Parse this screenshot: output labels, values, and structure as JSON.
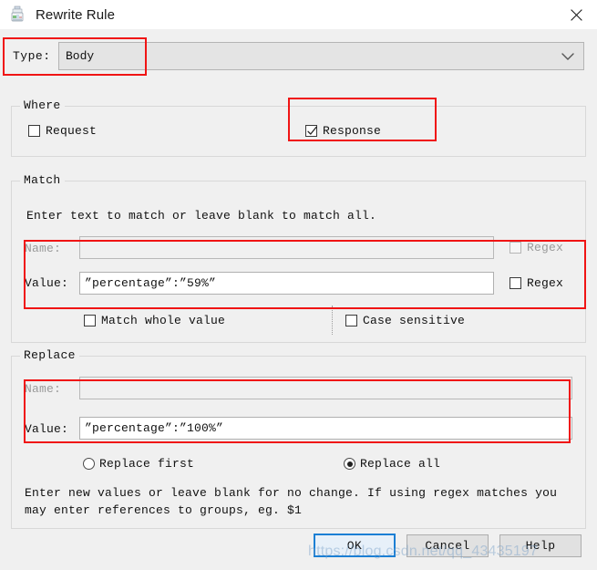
{
  "window": {
    "title": "Rewrite Rule",
    "icon": "charles-bottle-icon",
    "close_icon": "close-icon"
  },
  "type_row": {
    "label": "Type:",
    "selected": "Body",
    "dropdown_icon": "chevron-down-icon"
  },
  "where": {
    "legend": "Where",
    "request": {
      "label": "Request",
      "checked": false
    },
    "response": {
      "label": "Response",
      "checked": true
    }
  },
  "match": {
    "legend": "Match",
    "hint": "Enter text to match or leave blank to match all.",
    "name": {
      "label": "Name:",
      "value": "",
      "disabled": true
    },
    "name_regex": {
      "label": "Regex",
      "checked": false,
      "disabled": true
    },
    "value": {
      "label": "Value:",
      "value": "”percentage”:”59%”"
    },
    "value_regex": {
      "label": "Regex",
      "checked": false
    },
    "match_whole_value": {
      "label": "Match whole value",
      "checked": false
    },
    "case_sensitive": {
      "label": "Case sensitive",
      "checked": false
    }
  },
  "replace": {
    "legend": "Replace",
    "name": {
      "label": "Name:",
      "value": "",
      "disabled": true
    },
    "value": {
      "label": "Value:",
      "value": "”percentage”:”100%”"
    },
    "replace_first": {
      "label": "Replace first",
      "selected": false
    },
    "replace_all": {
      "label": "Replace all",
      "selected": true
    },
    "hint_line1": "Enter new values or leave blank for no change. If using regex matches you",
    "hint_line2": "may enter references to groups, eg. $1"
  },
  "footer": {
    "ok": "OK",
    "cancel": "Cancel",
    "help": "Help"
  },
  "watermark": "https://blog.csdn.net/qq_43435197",
  "colors": {
    "annotation_red": "#f01414",
    "accent_blue": "#1b7fd4",
    "dialog_bg": "#f0f0f0"
  }
}
